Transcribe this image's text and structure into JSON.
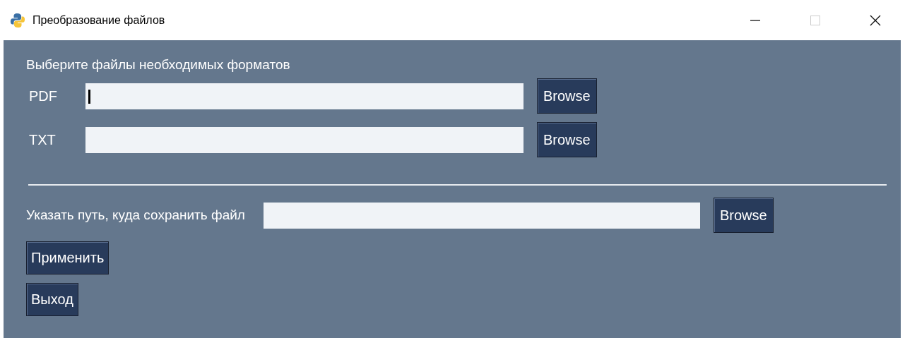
{
  "window": {
    "title": "Преобразование файлов",
    "controls": [
      {
        "kind": "minimize",
        "disabled": false
      },
      {
        "kind": "maximize",
        "disabled": true
      },
      {
        "kind": "close",
        "disabled": false
      }
    ]
  },
  "heading": "Выберите файлы необходимых форматов",
  "file_rows": [
    {
      "label": "PDF",
      "focused": true,
      "button": "Browse"
    },
    {
      "label": "TXT",
      "focused": false,
      "button": "Browse"
    }
  ],
  "save_row": {
    "label": "Указать путь, куда сохранить файл",
    "button": "Browse"
  },
  "buttons": [
    "Применить",
    "Выход"
  ]
}
